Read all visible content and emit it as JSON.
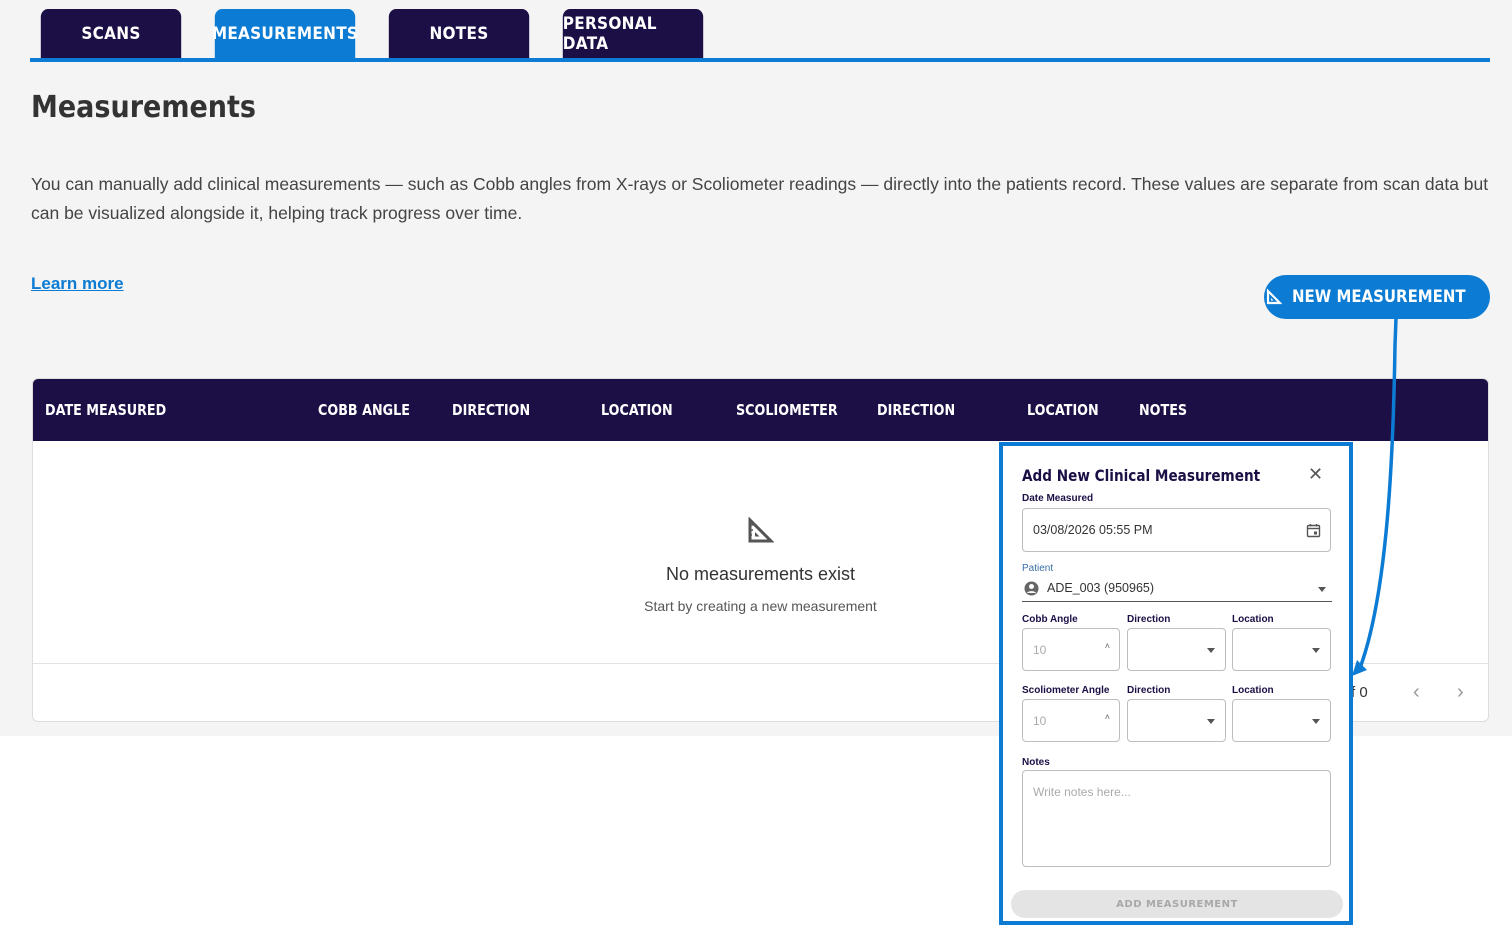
{
  "tabs": [
    {
      "label": "SCANS",
      "active": false
    },
    {
      "label": "MEASUREMENTS",
      "active": true
    },
    {
      "label": "NOTES",
      "active": false
    },
    {
      "label": "PERSONAL DATA",
      "active": false
    }
  ],
  "page": {
    "title": "Measurements",
    "description": "You can manually add clinical measurements — such as Cobb angles from X-rays or Scoliometer readings — directly into the patients record. These values are separate from scan data but can be visualized alongside it, helping track progress over time.",
    "learn_more": "Learn more",
    "new_button": "NEW MEASUREMENT"
  },
  "table": {
    "columns": [
      "DATE MEASURED",
      "COBB ANGLE",
      "DIRECTION",
      "LOCATION",
      "SCOLIOMETER",
      "DIRECTION",
      "LOCATION",
      "NOTES"
    ],
    "empty_title": "No measurements exist",
    "empty_subtitle": "Start by creating a new measurement",
    "pager_text": "f 0"
  },
  "modal": {
    "title": "Add New Clinical Measurement",
    "date_label": "Date Measured",
    "date_value": "03/08/2026 05:55 PM",
    "patient_label": "Patient",
    "patient_value": "ADE_003 (950965)",
    "cobb_label": "Cobb Angle",
    "cobb_placeholder": "10",
    "cobb_direction_label": "Direction",
    "cobb_location_label": "Location",
    "scolio_label": "Scoliometer Angle",
    "scolio_placeholder": "10",
    "scolio_direction_label": "Direction",
    "scolio_location_label": "Location",
    "notes_label": "Notes",
    "notes_placeholder": "Write notes here...",
    "add_button": "ADD MEASUREMENT"
  },
  "colors": {
    "navy": "#1c0f45",
    "accent": "#0b7bd3",
    "background": "#f4f4f5"
  }
}
